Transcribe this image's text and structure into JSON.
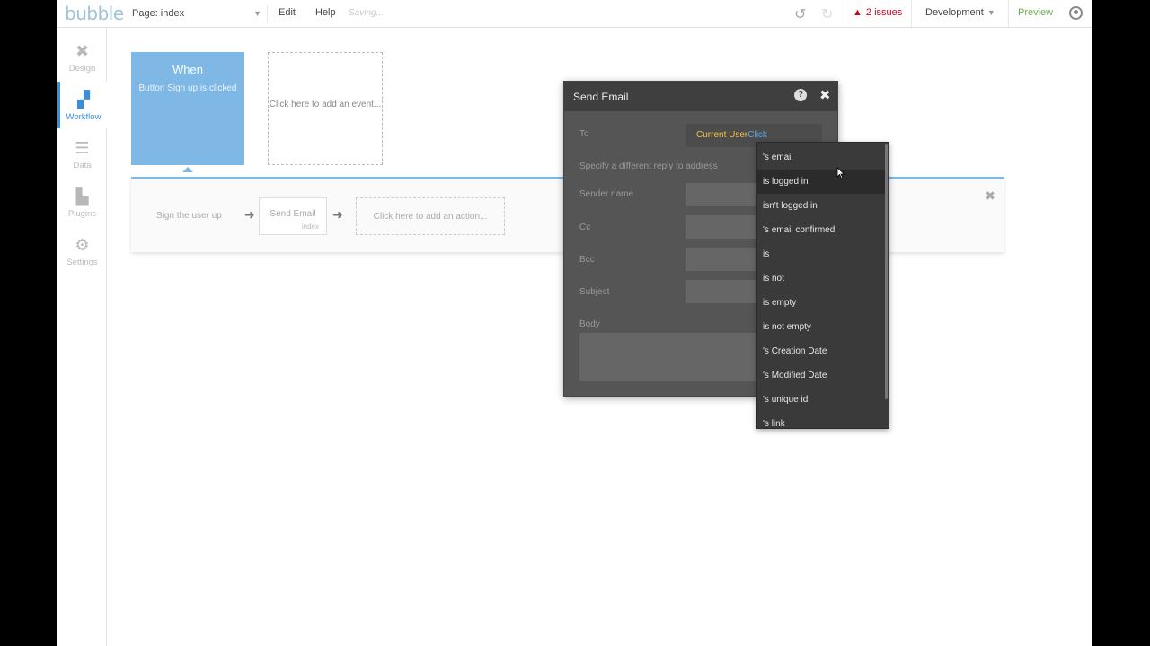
{
  "topbar": {
    "logo": "bubble",
    "page_select": "Page: index",
    "menu": [
      "Edit",
      "Help"
    ],
    "saving": "Saving...",
    "issues": "2 issues",
    "environment": "Development",
    "preview": "Preview"
  },
  "leftnav": {
    "items": [
      {
        "label": "Design",
        "icon": "design-icon"
      },
      {
        "label": "Workflow",
        "icon": "workflow-icon"
      },
      {
        "label": "Data",
        "icon": "data-icon"
      },
      {
        "label": "Plugins",
        "icon": "plugins-icon"
      },
      {
        "label": "Settings",
        "icon": "settings-icon"
      }
    ]
  },
  "workflow": {
    "event_title": "When",
    "event_desc": "Button Sign up is clicked",
    "add_event": "Click here to add an event...",
    "steps": [
      "Sign the user up",
      "Send Email"
    ],
    "step_sub": "index",
    "add_action": "Click here to add an action..."
  },
  "modal": {
    "title": "Send Email",
    "fields": {
      "to": "To",
      "to_value_dynamic": "Current User",
      "to_value_click": "Click",
      "reply_to": "Specify a different reply to address",
      "sender_name": "Sender name",
      "cc": "Cc",
      "bcc": "Bcc",
      "subject": "Subject",
      "body": "Body"
    }
  },
  "dropdown": {
    "items": [
      "'s email",
      "is logged in",
      "isn't logged in",
      "'s email confirmed",
      "is",
      "is not",
      "is empty",
      "is not empty",
      "'s Creation Date",
      "'s Modified Date",
      "'s unique id",
      "'s link"
    ],
    "hovered_index": 1
  },
  "colors": {
    "accent": "#7fb8e5",
    "issues": "#d0021b",
    "preview": "#6ab04c",
    "dynamic": "#f5c242",
    "click": "#5aa7e8"
  }
}
